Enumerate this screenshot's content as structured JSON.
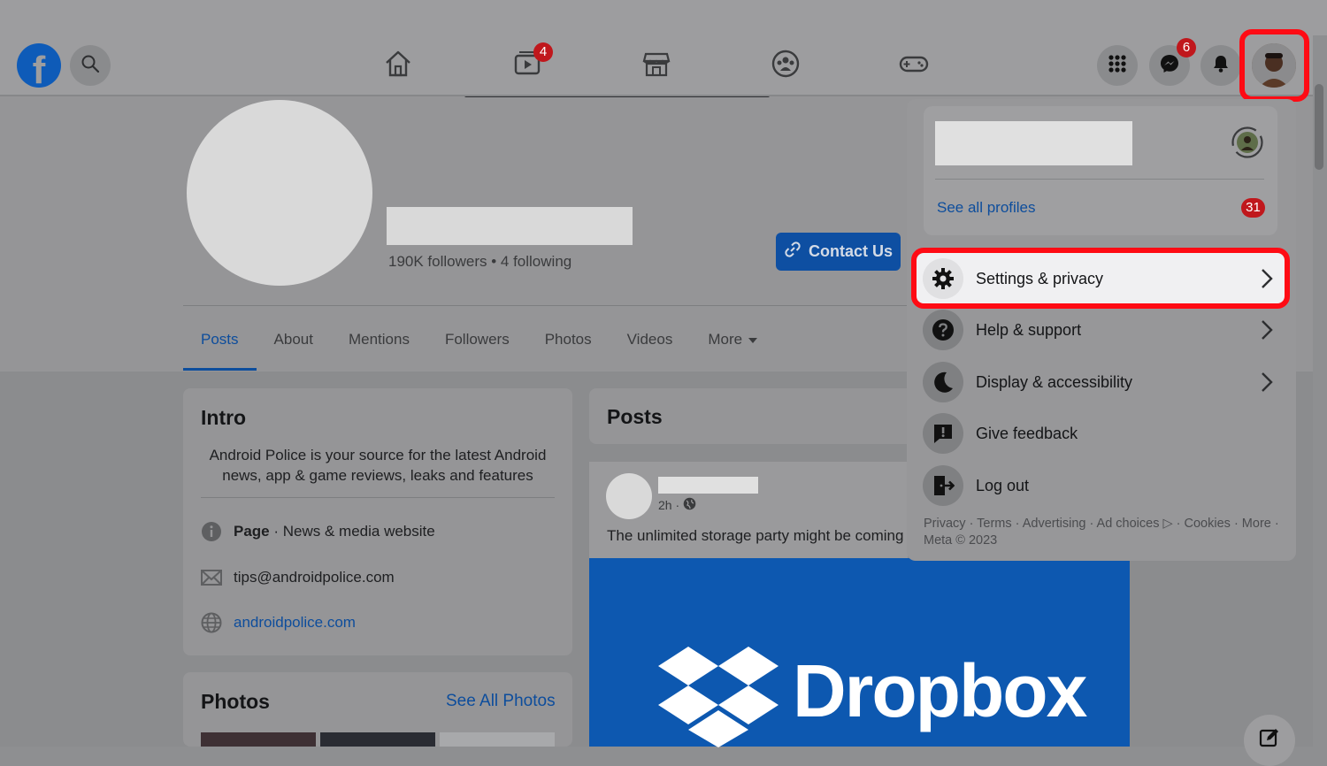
{
  "header": {
    "logo": "facebook-logo",
    "search_icon": "search-icon",
    "nav": [
      {
        "name": "home-icon",
        "badge": ""
      },
      {
        "name": "video-icon",
        "badge": "4"
      },
      {
        "name": "marketplace-icon",
        "badge": ""
      },
      {
        "name": "groups-icon",
        "badge": ""
      },
      {
        "name": "gaming-icon",
        "badge": ""
      }
    ],
    "right": {
      "menu_icon": "grid-menu-icon",
      "messenger_icon": "messenger-icon",
      "messenger_badge": "6",
      "notifications_icon": "bell-icon",
      "account_avatar": "account-avatar"
    }
  },
  "profile": {
    "followers": "190K followers • 4 following",
    "contact_button": "Contact Us",
    "tabs": [
      "Posts",
      "About",
      "Mentions",
      "Followers",
      "Photos",
      "Videos",
      "More"
    ]
  },
  "intro": {
    "title": "Intro",
    "bio": "Android Police is your source for the latest Android news, app & game reviews, leaks and features",
    "page_label": "Page",
    "page_category": " · News & media website",
    "email": "tips@androidpolice.com",
    "website": "androidpolice.com"
  },
  "photos": {
    "title": "Photos",
    "see_all": "See All Photos"
  },
  "posts": {
    "title": "Posts",
    "time": "2h ·",
    "text": "The unlimited storage party might be coming",
    "image_text": "Dropbox"
  },
  "account_menu": {
    "see_all_profiles": "See all profiles",
    "profiles_badge": "31",
    "items": [
      {
        "label": "Settings & privacy",
        "icon": "gear-icon",
        "chevron": true
      },
      {
        "label": "Help & support",
        "icon": "help-icon",
        "chevron": true
      },
      {
        "label": "Display & accessibility",
        "icon": "moon-icon",
        "chevron": true
      },
      {
        "label": "Give feedback",
        "icon": "feedback-icon",
        "chevron": false
      },
      {
        "label": "Log out",
        "icon": "logout-icon",
        "chevron": false
      }
    ],
    "footer_line1": "Privacy · Terms · Advertising · Ad choices ▷ · Cookies · More ·",
    "footer_line2": "Meta © 2023"
  },
  "colors": {
    "highlight_ring": "#ff0b14",
    "badge": "#c0171c",
    "link": "#0d4d9c"
  }
}
